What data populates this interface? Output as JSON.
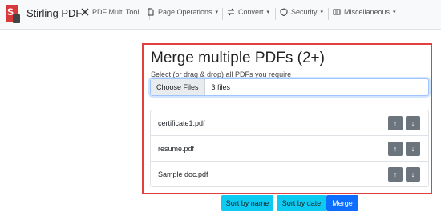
{
  "brand": {
    "name": "Stirling PDF"
  },
  "nav": {
    "items": [
      {
        "label": "PDF Multi Tool",
        "icon": "tools-icon",
        "dropdown": false
      },
      {
        "label": "Page Operations",
        "icon": "file-icon",
        "dropdown": true
      },
      {
        "label": "Convert",
        "icon": "arrows-icon",
        "dropdown": true
      },
      {
        "label": "Security",
        "icon": "shield-icon",
        "dropdown": true
      },
      {
        "label": "Miscellaneous",
        "icon": "card-icon",
        "dropdown": true
      }
    ],
    "caret": "▾"
  },
  "merge": {
    "title": "Merge multiple PDFs (2+)",
    "hint": "Select (or drag & drop) all PDFs you require",
    "choose_label": "Choose Files",
    "files_selected": "3 files",
    "files": [
      {
        "name": "certificate1.pdf"
      },
      {
        "name": "resume.pdf"
      },
      {
        "name": "Sample doc.pdf"
      }
    ],
    "up_glyph": "↑",
    "down_glyph": "↓"
  },
  "actions": {
    "sort_name": "Sort by name",
    "sort_date": "Sort by date",
    "merge": "Merge"
  },
  "colors": {
    "highlight": "#e04040",
    "info": "#0dcaf0",
    "primary": "#0d6efd",
    "secondary": "#6c757d"
  }
}
